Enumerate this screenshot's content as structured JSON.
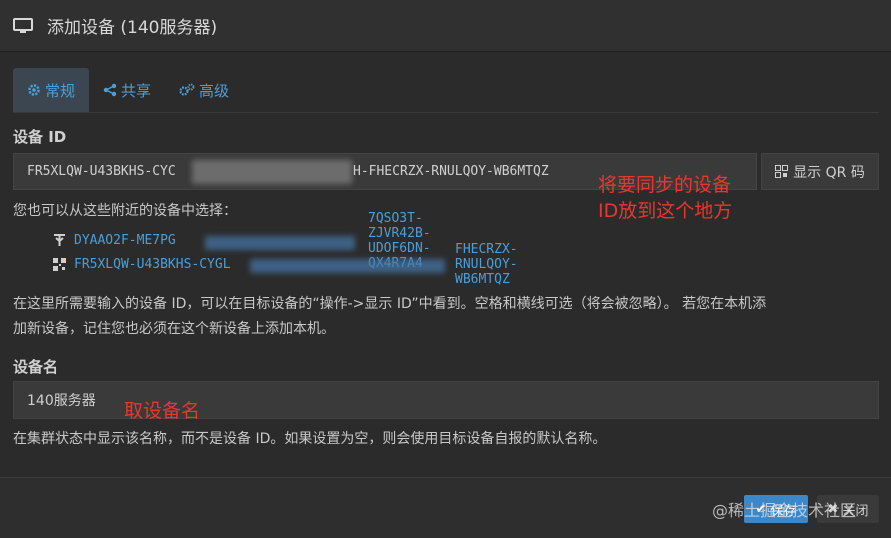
{
  "header": {
    "title": "添加设备 (140服务器)",
    "icon": "monitor-icon"
  },
  "tabs": [
    {
      "label": "常规",
      "icon": "gear-icon",
      "active": true
    },
    {
      "label": "共享",
      "icon": "share-icon",
      "active": false
    },
    {
      "label": "高级",
      "icon": "gears-icon",
      "active": false
    }
  ],
  "device_id": {
    "label": "设备 ID",
    "value_start": "FR5XLQW-U43BKHS-CYC",
    "value_end": "H-FHECRZX-RNULQOY-WB6MTQZ",
    "qr_button": "显示 QR 码"
  },
  "nearby": {
    "intro": "您也可以从这些附近的设备中选择：",
    "items": [
      {
        "start": "DYAAO2F-ME7PG",
        "end": "7QSO3T-ZJVR42B-UDOF6DN-QX4R7A4",
        "icon": "antenna-icon"
      },
      {
        "start": "FR5XLQW-U43BKHS-CYGL",
        "end": "FHECRZX-RNULQOY-WB6MTQZ",
        "icon": "qr-icon"
      }
    ]
  },
  "help": {
    "line1": "在这里所需要输入的设备 ID，可以在目标设备的“操作->显示 ID”中看到。空格和横线可选（将会被忽略）。 若您在本机添",
    "line2": "加新设备，记住您也必须在这个新设备上添加本机。"
  },
  "device_name": {
    "label": "设备名",
    "value": "140服务器",
    "help": "在集群状态中显示该名称，而不是设备 ID。如果设置为空，则会使用目标设备自报的默认名称。"
  },
  "annotations": {
    "a1_line1": "将要同步的设备",
    "a1_line2": "ID放到这个地方",
    "a2": "取设备名"
  },
  "footer": {
    "save": "保存",
    "close": "关闭",
    "watermark": "@稀土掘金技术社区"
  },
  "colors": {
    "accent": "#4a9fd8",
    "annotation": "#e8382d",
    "save": "#3a87c9"
  }
}
